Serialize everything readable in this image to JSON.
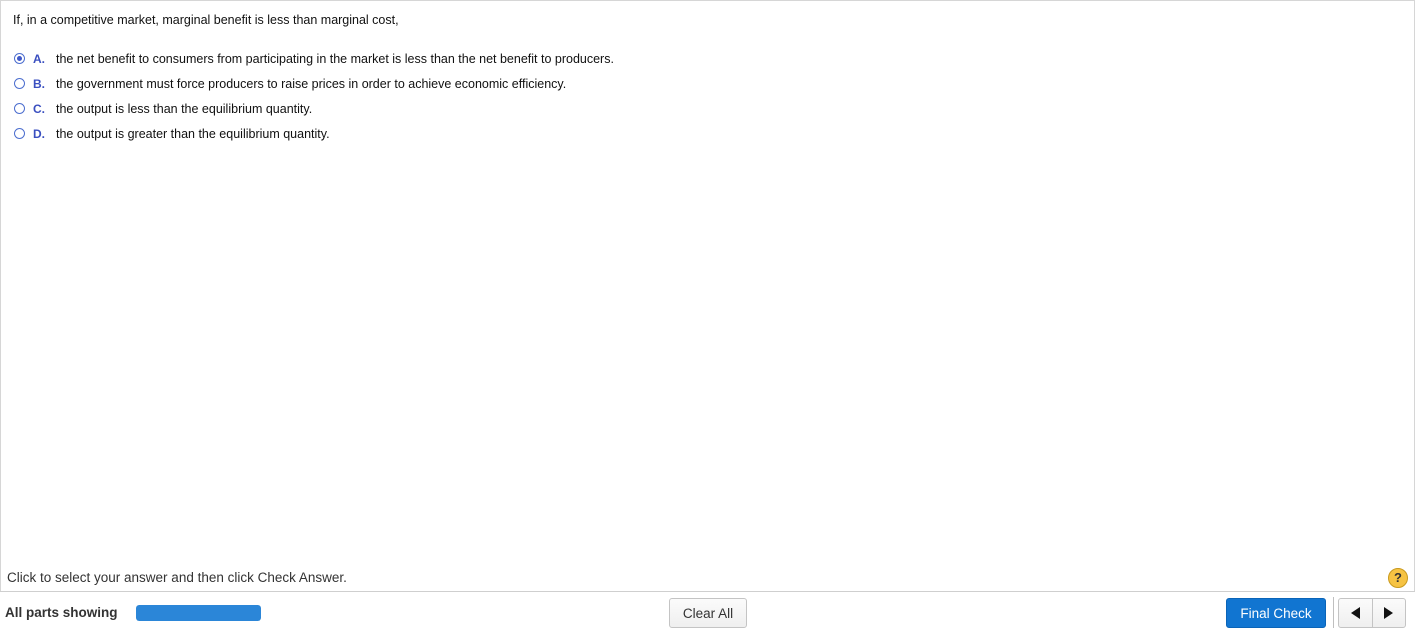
{
  "question": {
    "text": "If, in a competitive market, marginal benefit is less than marginal cost,",
    "options": [
      {
        "letter": "A.",
        "text": "the net benefit to consumers from participating in the market is less than the net benefit to producers.",
        "selected": true
      },
      {
        "letter": "B.",
        "text": "the government must force producers to raise prices in order to achieve economic efficiency.",
        "selected": false
      },
      {
        "letter": "C.",
        "text": "the output is less than the equilibrium quantity.",
        "selected": false
      },
      {
        "letter": "D.",
        "text": "the output is greater than the equilibrium quantity.",
        "selected": false
      }
    ]
  },
  "footer": {
    "instruction": "Click to select your answer and then click Check Answer.",
    "help_icon": "question-mark-icon",
    "help_glyph": "?",
    "parts_label": "All parts showing",
    "progress_fraction": 1.0,
    "clear_label": "Clear All",
    "final_label": "Final Check",
    "prev_icon": "triangle-left-icon",
    "next_icon": "triangle-right-icon"
  },
  "colors": {
    "accent": "#1175d1",
    "progress": "#2b86d8",
    "option_letter": "#3a4fc0",
    "help_icon": "#f6c343"
  }
}
